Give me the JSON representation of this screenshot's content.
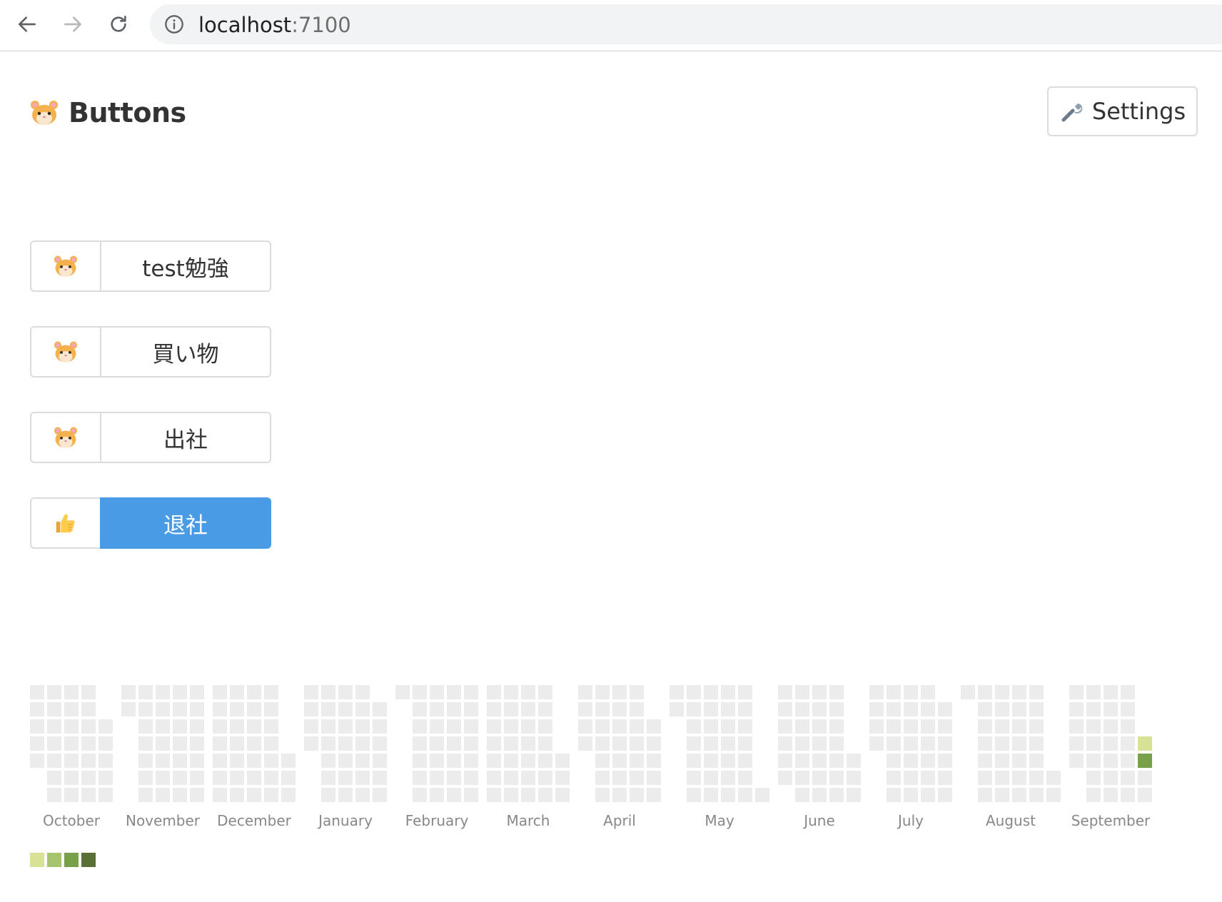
{
  "browser": {
    "url_host": "localhost",
    "url_port": ":7100"
  },
  "header": {
    "title": "Buttons",
    "settings_label": "Settings"
  },
  "actions": [
    {
      "icon": "hamster-icon",
      "label": "test勉強",
      "active": false
    },
    {
      "icon": "hamster-icon",
      "label": "買い物",
      "active": false
    },
    {
      "icon": "hamster-icon",
      "label": "出社",
      "active": false
    },
    {
      "icon": "thumbs-up-icon",
      "label": "退社",
      "active": true
    }
  ],
  "heatmap": {
    "months": [
      "October",
      "November",
      "December",
      "January",
      "February",
      "March",
      "April",
      "May",
      "June",
      "July",
      "August",
      "September"
    ],
    "colors": {
      "empty": "#ececec",
      "levels": [
        "#d9e196",
        "#a6c46b",
        "#789f4a",
        "#587036"
      ]
    },
    "active_days": [
      {
        "month": "September",
        "day": 29,
        "level": 3
      },
      {
        "month": "September",
        "day": 30,
        "level": 1
      }
    ]
  }
}
